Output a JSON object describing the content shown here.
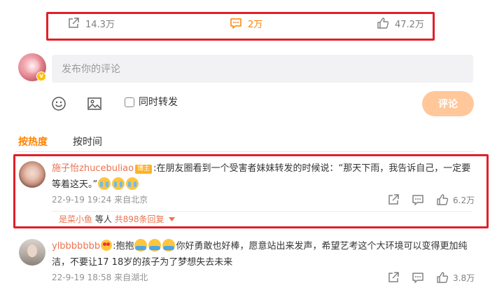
{
  "stats": {
    "reposts": "14.3万",
    "comments": "2万",
    "likes": "47.2万"
  },
  "composer": {
    "placeholder": "发布你的评论",
    "repost_label": "同时转发",
    "submit_label": "评论",
    "verified_badge": "v"
  },
  "sort": {
    "hot_label": "按热度",
    "time_label": "按时间"
  },
  "comments": [
    {
      "user": "施子怡zhucebuliao",
      "badge": "博主",
      "text": ":在朋友圈看到一个受害者妹妹转发的时候说：“那天下雨，我告诉自己，一定要等着这天。”",
      "time": "22-9-19 19:24",
      "location": "来自北京",
      "likes": "6.2万",
      "reply_user": "是菜小鱼",
      "reply_mid": " 等人 ",
      "reply_more": "共898条回复"
    },
    {
      "user": "ylbbbbbbb",
      "text_a": ":抱抱",
      "text_b": "你好勇敢也好棒，愿意站出来发声，希望艺考这个大环境可以变得更加纯洁，不要让17 18岁的孩子为了梦想失去未来",
      "time": "22-9-19 18:58",
      "location": "来自湖北",
      "likes": "3.8万"
    }
  ],
  "colors": {
    "accent": "#ff8200",
    "username": "#eb7350",
    "highlight_border": "#e0202a",
    "submit_disabled": "#ffc79a"
  }
}
